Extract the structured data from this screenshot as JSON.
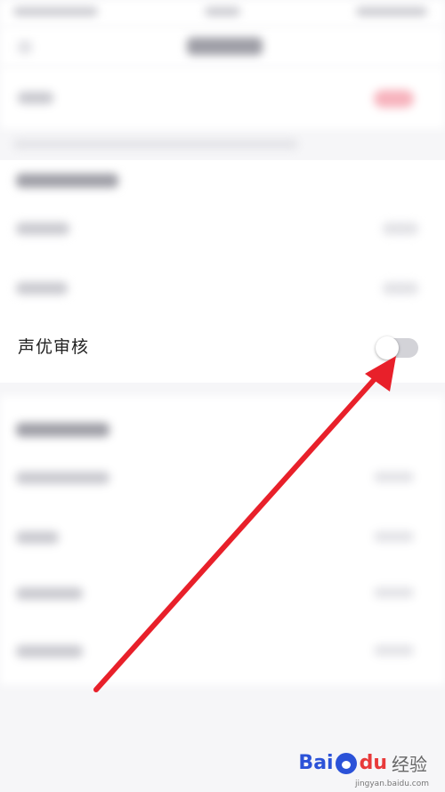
{
  "settings": {
    "voice_review": {
      "label": "声优审核",
      "enabled": false
    }
  },
  "colors": {
    "annotation_arrow": "#e8202a",
    "toggle_off": "#d3d3d8"
  },
  "icons": {
    "back": "chevron-left-icon",
    "toggle": "toggle-switch-icon"
  },
  "watermark": {
    "brand_bai": "Bai",
    "brand_du": "du",
    "brand_jingyan": "经验",
    "url": "jingyan.baidu.com"
  }
}
